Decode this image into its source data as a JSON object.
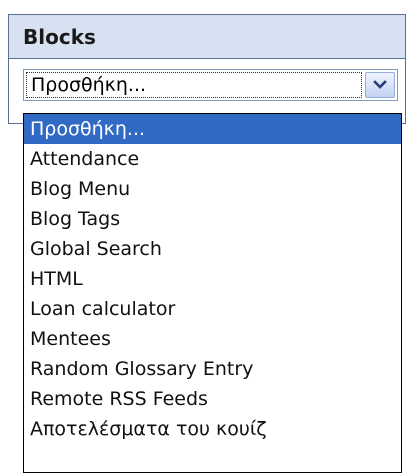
{
  "block": {
    "title": "Blocks"
  },
  "select": {
    "value": "Προσθήκη...",
    "icon": "chevron-down-icon"
  },
  "dropdown": {
    "options": [
      "Προσθήκη...",
      "Attendance",
      "Blog Menu",
      "Blog Tags",
      "Global Search",
      "HTML",
      "Loan calculator",
      "Mentees",
      "Random Glossary Entry",
      "Remote RSS Feeds",
      "Αποτελέσματα του κουίζ"
    ],
    "selected_index": 0
  },
  "colors": {
    "header_bg": "#d7e1f1",
    "border": "#5a6f96",
    "highlight": "#316ac5"
  }
}
